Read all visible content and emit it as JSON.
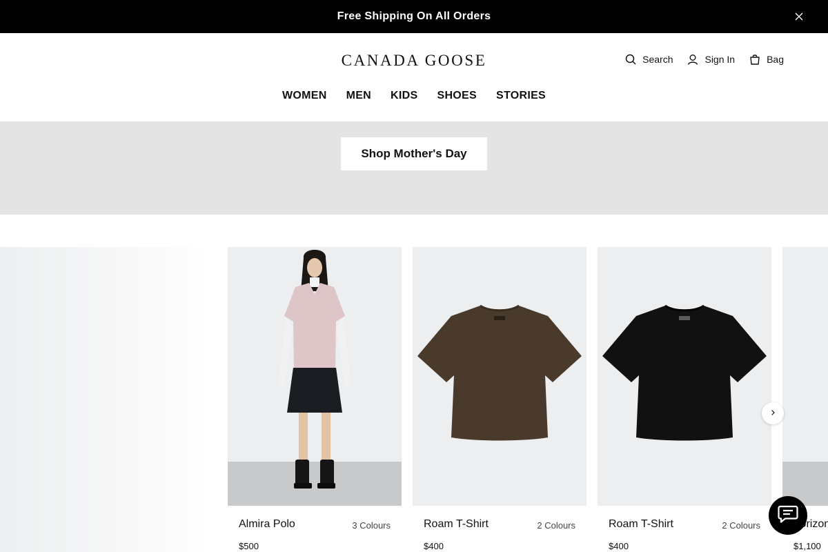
{
  "promo": {
    "text": "Free Shipping On All Orders"
  },
  "header": {
    "logo": "CANADA GOOSE",
    "search_label": "Search",
    "sign_in_label": "Sign In",
    "bag_label": "Bag"
  },
  "nav": {
    "items": [
      {
        "label": "WOMEN"
      },
      {
        "label": "MEN"
      },
      {
        "label": "KIDS"
      },
      {
        "label": "SHOES"
      },
      {
        "label": "STORIES"
      }
    ]
  },
  "hero": {
    "cta_label": "Shop Mother's Day"
  },
  "carousel": {
    "products": [
      {
        "name": "Almira Polo",
        "colours": "3 Colours",
        "price": "$500"
      },
      {
        "name": "Roam T-Shirt",
        "colours": "2 Colours",
        "price": "$400"
      },
      {
        "name": "Roam T-Shirt",
        "colours": "2 Colours",
        "price": "$400"
      },
      {
        "name": "Horizon",
        "colours": "",
        "price": "$1,100"
      }
    ]
  },
  "icons": {
    "close": "close-icon",
    "search": "search-icon",
    "user": "user-icon",
    "bag": "bag-icon",
    "next": "chevron-right-icon",
    "chat": "chat-icon"
  },
  "colors": {
    "promo_bg": "#000000",
    "hero_bg": "#e4e4e4",
    "card_bg": "#eceef0",
    "tee_brown": "#4a3a2c",
    "tee_black": "#111111"
  }
}
